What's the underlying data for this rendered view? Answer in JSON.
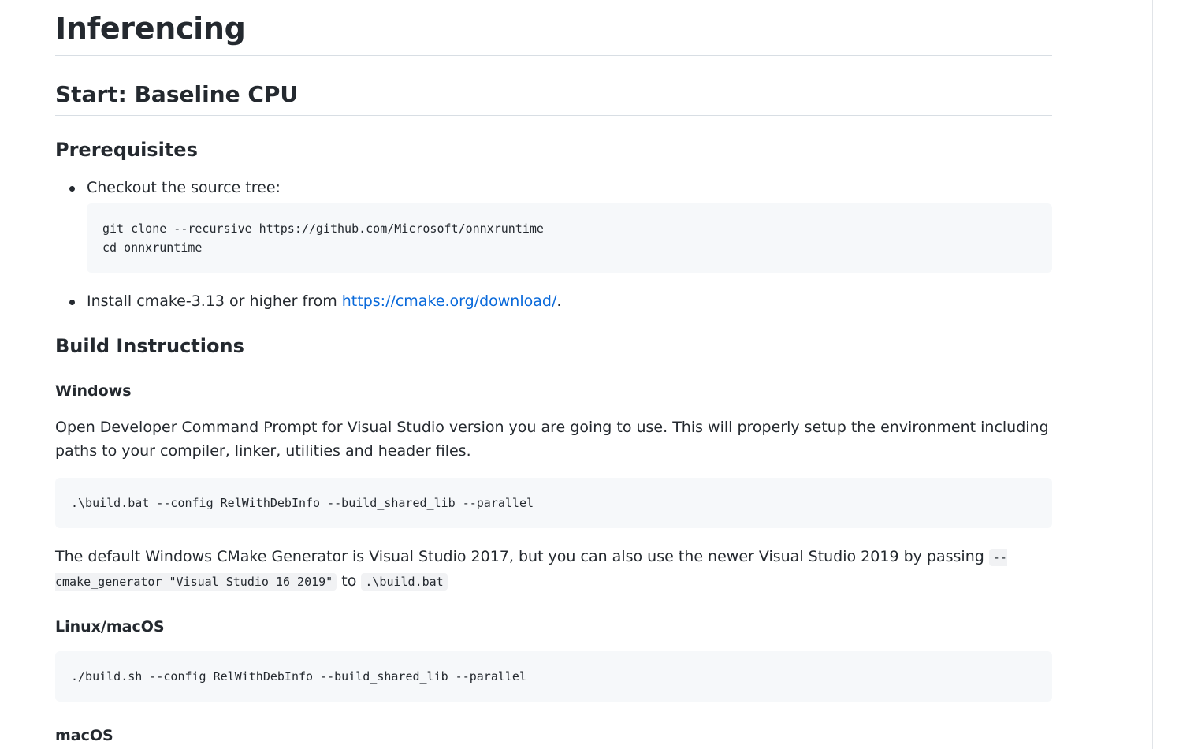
{
  "page": {
    "title": "Inferencing",
    "section_title": "Start: Baseline CPU"
  },
  "prereq": {
    "heading": "Prerequisites",
    "item1_text": "Checkout the source tree:",
    "item1_code": "git clone --recursive https://github.com/Microsoft/onnxruntime\ncd onnxruntime",
    "item2_prefix": "Install cmake-3.13 or higher from ",
    "item2_link": "https://cmake.org/download/",
    "item2_suffix": "."
  },
  "build": {
    "heading": "Build Instructions",
    "windows": {
      "heading": "Windows",
      "description": "Open Developer Command Prompt for Visual Studio version you are going to use. This will properly setup the environment including paths to your compiler, linker, utilities and header files.",
      "code": ".\\build.bat --config RelWithDebInfo --build_shared_lib --parallel",
      "note_prefix": "The default Windows CMake Generator is Visual Studio 2017, but you can also use the newer Visual Studio 2019 by passing ",
      "note_code1": "--cmake_generator \"Visual Studio 16 2019\"",
      "note_mid": " to ",
      "note_code2": ".\\build.bat"
    },
    "linux": {
      "heading": "Linux/macOS",
      "code": "./build.sh --config RelWithDebInfo --build_shared_lib --parallel"
    },
    "macos": {
      "heading": "macOS"
    }
  },
  "colors": {
    "link": "#0969da",
    "code_bg": "#f6f8fa",
    "text": "#24292f"
  }
}
